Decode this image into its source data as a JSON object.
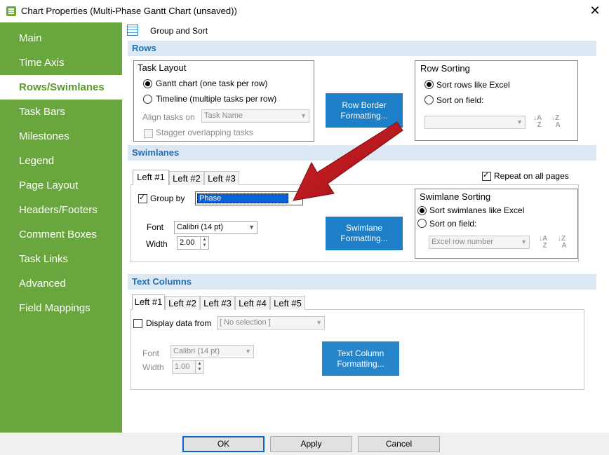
{
  "window": {
    "title": "Chart Properties (Multi-Phase Gantt Chart (unsaved))",
    "close": "✕"
  },
  "sidebar": {
    "items": [
      {
        "label": "Main"
      },
      {
        "label": "Time Axis"
      },
      {
        "label": "Rows/Swimlanes"
      },
      {
        "label": "Task Bars"
      },
      {
        "label": "Milestones"
      },
      {
        "label": "Legend"
      },
      {
        "label": "Page Layout"
      },
      {
        "label": "Headers/Footers"
      },
      {
        "label": "Comment Boxes"
      },
      {
        "label": "Task Links"
      },
      {
        "label": "Advanced"
      },
      {
        "label": "Field Mappings"
      }
    ],
    "selected": "Rows/Swimlanes",
    "color": "#69a63d"
  },
  "toolbar": {
    "label": "Group and Sort",
    "icon": "table-icon"
  },
  "rows": {
    "header": "Rows",
    "task_layout": {
      "title": "Task Layout",
      "opt_gantt": "Gantt chart (one task per row)",
      "opt_timeline": "Timeline (multiple tasks per row)",
      "align_label": "Align tasks on",
      "align_value": "Task Name",
      "stagger": "Stagger overlapping tasks"
    },
    "border_button": "Row Border\nFormatting...",
    "sorting": {
      "title": "Row Sorting",
      "opt_excel": "Sort rows like Excel",
      "opt_field": "Sort on field:",
      "field_value": ""
    }
  },
  "swimlanes": {
    "header": "Swimlanes",
    "tabs": [
      "Left #1",
      "Left #2",
      "Left #3"
    ],
    "repeat": "Repeat on all pages",
    "group_by": "Group by",
    "group_value": "Phase",
    "font_label": "Font",
    "font_value": "Calibri (14 pt)",
    "width_label": "Width",
    "width_value": "2.00",
    "format_button": "Swimlane\nFormatting...",
    "sorting": {
      "title": "Swimlane Sorting",
      "opt_excel": "Sort swimlanes like Excel",
      "opt_field": "Sort on field:",
      "field_value": "Excel row number"
    }
  },
  "text_columns": {
    "header": "Text Columns",
    "tabs": [
      "Left #1",
      "Left #2",
      "Left #3",
      "Left #4",
      "Left #5"
    ],
    "display_label": "Display data from",
    "display_value": "[ No selection ]",
    "font_label": "Font",
    "font_value": "Calibri (14 pt)",
    "width_label": "Width",
    "width_value": "1.00",
    "format_button": "Text Column\nFormatting..."
  },
  "footer": {
    "ok": "OK",
    "apply": "Apply",
    "cancel": "Cancel"
  },
  "colors": {
    "accent_blue": "#1c7fc7",
    "annotation_arrow": "#c0151b",
    "section_bg": "#dce9f5"
  }
}
